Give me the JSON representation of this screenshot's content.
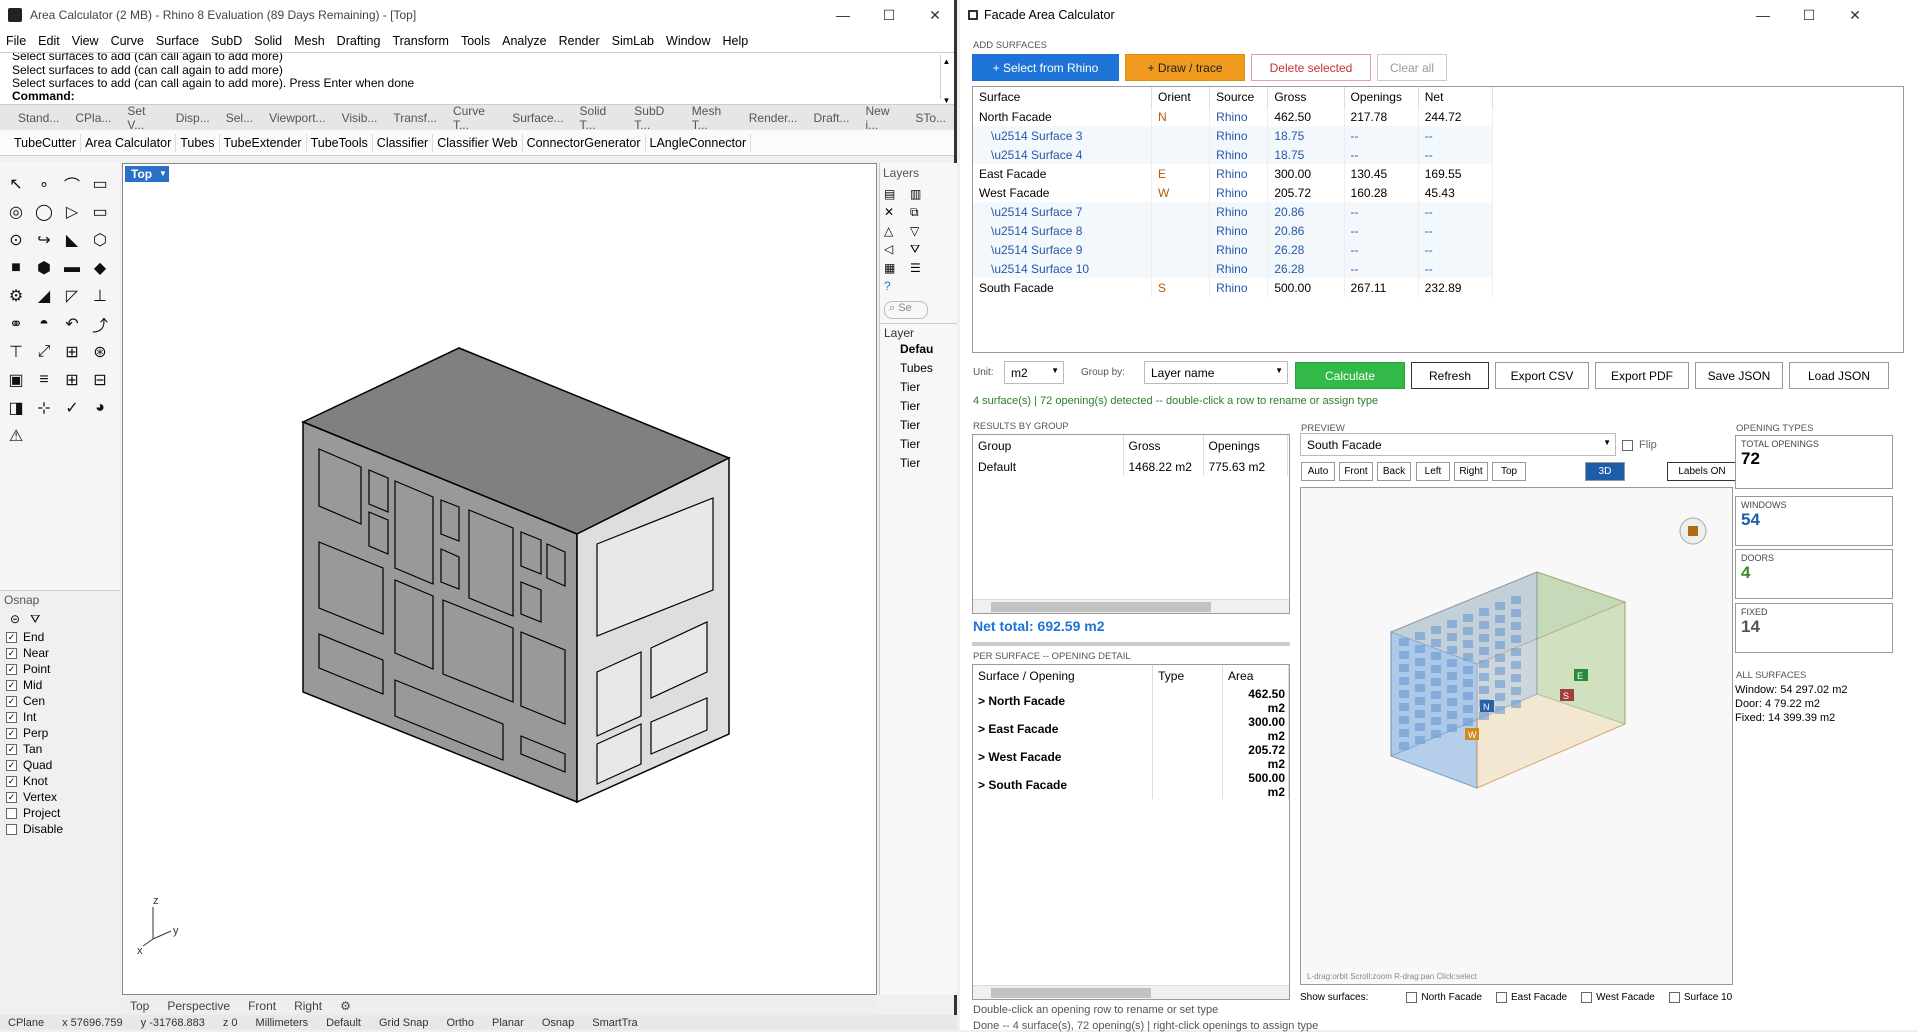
{
  "rhino": {
    "title": "Area Calculator (2 MB) - Rhino 8 Evaluation (89 Days Remaining) - [Top]",
    "menu": [
      "File",
      "Edit",
      "View",
      "Curve",
      "Surface",
      "SubD",
      "Solid",
      "Mesh",
      "Drafting",
      "Transform",
      "Tools",
      "Analyze",
      "Render",
      "SimLab",
      "Window",
      "Help"
    ],
    "history": [
      "Select surfaces to add (can call again to add more)",
      "Select surfaces to add (can call again to add more)",
      "Select surfaces to add (can call again to add more). Press Enter when done"
    ],
    "command_label": "Command:",
    "tabs": [
      "Stand...",
      "CPla...",
      "Set V...",
      "Disp...",
      "Sel...",
      "Viewport...",
      "Visib...",
      "Transf...",
      "Curve T...",
      "Surface...",
      "Solid T...",
      "SubD T...",
      "Mesh T...",
      "Render...",
      "Draft...",
      "New i...",
      "STo..."
    ],
    "plugins": [
      "TubeCutter",
      "Area Calculator",
      "Tubes",
      "TubeExtender",
      "TubeTools",
      "Classifier",
      "Classifier Web",
      "ConnectorGenerator",
      "LAngleConnector"
    ],
    "viewport_label": "Top",
    "viewport_tabs": [
      "Top",
      "Perspective",
      "Front",
      "Right"
    ],
    "axis": {
      "z": "z",
      "x": "x",
      "y": "y"
    },
    "layers_title": "Layers",
    "layers_search": "Se",
    "layer_header": "Layer",
    "layer_items": [
      "Defau",
      "Tubes",
      "Tier",
      "Tier",
      "Tier",
      "Tier",
      "Tier"
    ],
    "osnap_title": "Osnap",
    "osnap": [
      {
        "label": "End",
        "checked": true
      },
      {
        "label": "Near",
        "checked": true
      },
      {
        "label": "Point",
        "checked": true
      },
      {
        "label": "Mid",
        "checked": true
      },
      {
        "label": "Cen",
        "checked": true
      },
      {
        "label": "Int",
        "checked": true
      },
      {
        "label": "Perp",
        "checked": true
      },
      {
        "label": "Tan",
        "checked": true
      },
      {
        "label": "Quad",
        "checked": true
      },
      {
        "label": "Knot",
        "checked": true
      },
      {
        "label": "Vertex",
        "checked": true
      },
      {
        "label": "Project",
        "checked": false
      },
      {
        "label": "Disable",
        "checked": false
      }
    ],
    "status": [
      "CPlane",
      "x 57696.759",
      "y -31768.883",
      "z 0",
      "Millimeters",
      "Default",
      "Grid Snap",
      "Ortho",
      "Planar",
      "Osnap",
      "SmartTra"
    ]
  },
  "fac": {
    "title": "Facade Area Calculator",
    "add_surfaces": "ADD SURFACES",
    "buttons": {
      "select": "+ Select from Rhino",
      "draw": "+ Draw / trace",
      "delete": "Delete selected",
      "clear": "Clear all"
    },
    "columns": [
      "Surface",
      "Orient",
      "Source",
      "Gross",
      "Openings",
      "Net"
    ],
    "rows": [
      {
        "name": "North Facade",
        "orient": "N",
        "source": "Rhino",
        "gross": "462.50",
        "openings": "217.78",
        "net": "244.72",
        "child": false
      },
      {
        "name": "\\u2514 Surface 3",
        "orient": "",
        "source": "Rhino",
        "gross": "18.75",
        "openings": "--",
        "net": "--",
        "child": true
      },
      {
        "name": "\\u2514 Surface 4",
        "orient": "",
        "source": "Rhino",
        "gross": "18.75",
        "openings": "--",
        "net": "--",
        "child": true
      },
      {
        "name": "East Facade",
        "orient": "E",
        "source": "Rhino",
        "gross": "300.00",
        "openings": "130.45",
        "net": "169.55",
        "child": false
      },
      {
        "name": "West Facade",
        "orient": "W",
        "source": "Rhino",
        "gross": "205.72",
        "openings": "160.28",
        "net": "45.43",
        "child": false
      },
      {
        "name": "\\u2514 Surface 7",
        "orient": "",
        "source": "Rhino",
        "gross": "20.86",
        "openings": "--",
        "net": "--",
        "child": true
      },
      {
        "name": "\\u2514 Surface 8",
        "orient": "",
        "source": "Rhino",
        "gross": "20.86",
        "openings": "--",
        "net": "--",
        "child": true
      },
      {
        "name": "\\u2514 Surface 9",
        "orient": "",
        "source": "Rhino",
        "gross": "26.28",
        "openings": "--",
        "net": "--",
        "child": true
      },
      {
        "name": "\\u2514 Surface 10",
        "orient": "",
        "source": "Rhino",
        "gross": "26.28",
        "openings": "--",
        "net": "--",
        "child": true
      },
      {
        "name": "South Facade",
        "orient": "S",
        "source": "Rhino",
        "gross": "500.00",
        "openings": "267.11",
        "net": "232.89",
        "child": false
      }
    ],
    "unit_label": "Unit:",
    "unit_value": "m2",
    "groupby_label": "Group by:",
    "groupby_value": "Layer name",
    "actions": {
      "calculate": "Calculate",
      "refresh": "Refresh",
      "csv": "Export CSV",
      "pdf": "Export PDF",
      "savejson": "Save JSON",
      "loadjson": "Load JSON"
    },
    "status_line": "4 surface(s) | 72 opening(s) detected -- double-click a row to rename or assign type",
    "results_title": "RESULTS BY GROUP",
    "results_cols": [
      "Group",
      "Gross",
      "Openings"
    ],
    "results_rows": [
      {
        "group": "Default",
        "gross": "1468.22 m2",
        "openings": "775.63 m2"
      }
    ],
    "net_total": "Net total: 692.59 m2",
    "per_title": "PER SURFACE -- OPENING DETAIL",
    "per_cols": [
      "Surface / Opening",
      "Type",
      "Area"
    ],
    "per_rows": [
      {
        "name": "> North Facade",
        "type": "",
        "area": "462.50 m2"
      },
      {
        "name": "> East Facade",
        "type": "",
        "area": "300.00 m2"
      },
      {
        "name": "> West Facade",
        "type": "",
        "area": "205.72 m2"
      },
      {
        "name": "> South Facade",
        "type": "",
        "area": "500.00 m2"
      }
    ],
    "preview_title": "PREVIEW",
    "preview_select": "South Facade",
    "flip": "Flip",
    "views": [
      "Auto",
      "Front",
      "Back",
      "Left",
      "Right",
      "Top",
      "3D",
      "Labels ON"
    ],
    "preview_hint": "L-drag:orbit   Scroll:zoom   R-drag:pan   Click:select",
    "opening_types": "OPENING TYPES",
    "cards": [
      {
        "label": "TOTAL OPENINGS",
        "num": "72",
        "color": "#000000"
      },
      {
        "label": "WINDOWS",
        "num": "54",
        "color": "#1e5ea8"
      },
      {
        "label": "DOORS",
        "num": "4",
        "color": "#3a8a2a"
      },
      {
        "label": "FIXED",
        "num": "14",
        "color": "#555555"
      }
    ],
    "all_surfaces": "ALL SURFACES",
    "all_lines": [
      "Window: 54   297.02 m2",
      "Door: 4   79.22 m2",
      "Fixed: 14   399.39 m2"
    ],
    "show_surfaces": "Show surfaces:",
    "show_items": [
      "North Facade",
      "East Facade",
      "West Facade",
      "Surface 10"
    ],
    "footer1": "Double-click an opening row to rename or set type",
    "footer2": "Done -- 4 surface(s), 72 opening(s)  |  right-click openings to assign type"
  }
}
